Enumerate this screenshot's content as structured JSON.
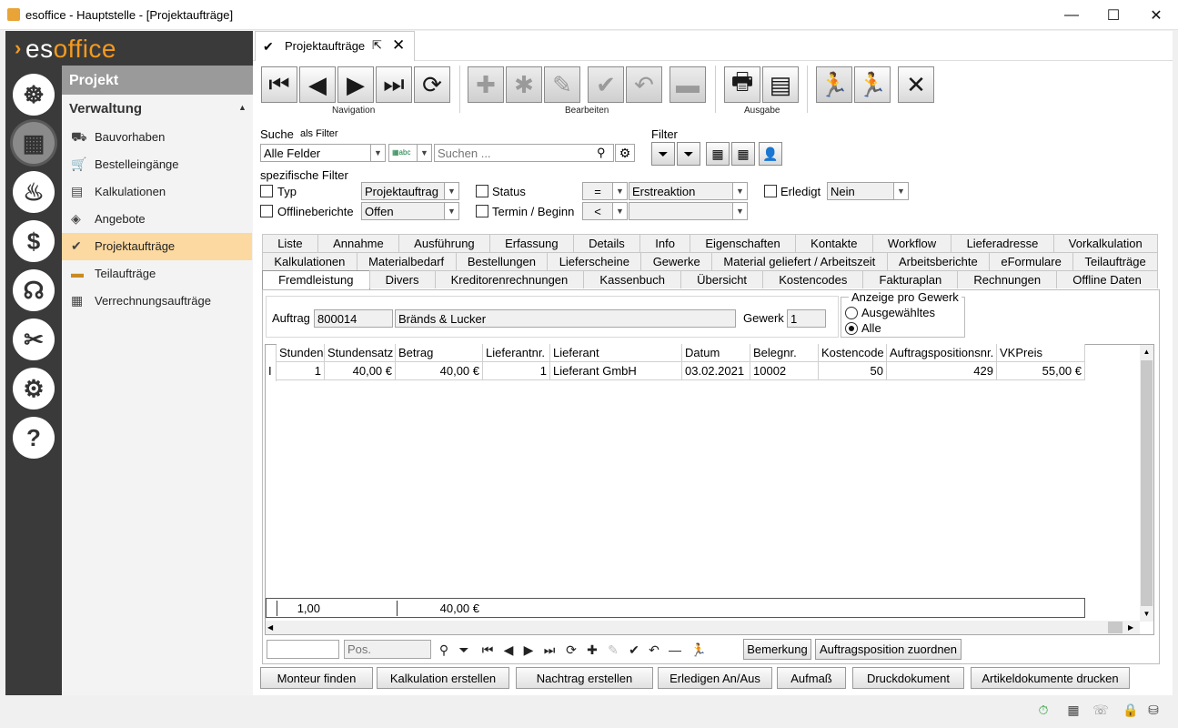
{
  "window": {
    "title": "esoffice - Hauptstelle - [Projektaufträge]",
    "minimize": "—",
    "maximize": "☐",
    "close": "✕"
  },
  "brand": {
    "logo_mark": "›",
    "logo_prefix": "es",
    "logo_suffix": "office",
    "accent": "#f39a1e"
  },
  "rail": [
    "steering-wheel-icon",
    "project-icon",
    "alarm-icon",
    "money-icon",
    "headset-icon",
    "tools-icon",
    "gears-icon",
    "help-icon"
  ],
  "nav": {
    "header": "Projekt",
    "section": "Verwaltung",
    "items": [
      {
        "label": "Bauvorhaben",
        "icon": "excavator-icon"
      },
      {
        "label": "Bestelleingänge",
        "icon": "cart-icon"
      },
      {
        "label": "Kalkulationen",
        "icon": "calculator-icon"
      },
      {
        "label": "Angebote",
        "icon": "offer-icon"
      },
      {
        "label": "Projektaufträge",
        "icon": "check-circle-icon",
        "selected": true
      },
      {
        "label": "Teilaufträge",
        "icon": "stack-icon"
      },
      {
        "label": "Verrechnungsaufträge",
        "icon": "billing-icon"
      }
    ]
  },
  "doctab": {
    "label": "Projektaufträge"
  },
  "toolbar": {
    "navigation_label": "Navigation",
    "edit_label": "Bearbeiten",
    "output_label": "Ausgabe"
  },
  "search": {
    "label": "Suche",
    "as_filter": "als Filter",
    "scope": "Alle Felder",
    "placeholder": "Suchen ..."
  },
  "filter": {
    "label": "Filter",
    "specific": "spezifische Filter"
  },
  "specific_filters": {
    "typ_label": "Typ",
    "typ_value": "Projektauftrag",
    "status_label": "Status",
    "status_op": "=",
    "status_value": "Erstreaktion",
    "erledigt_label": "Erledigt",
    "erledigt_value": "Nein",
    "offline_label": "Offlineberichte",
    "offline_value": "Offen",
    "termin_label": "Termin / Beginn",
    "termin_op": "<",
    "termin_value": ""
  },
  "tabs_row1": [
    "Liste",
    "Annahme",
    "Ausführung",
    "Erfassung",
    "Details",
    "Info",
    "Eigenschaften",
    "Kontakte",
    "Workflow",
    "Lieferadresse",
    "Vorkalkulation"
  ],
  "tabs_row2": [
    "Kalkulationen",
    "Materialbedarf",
    "Bestellungen",
    "Lieferscheine",
    "Gewerke",
    "Material geliefert / Arbeitszeit",
    "Arbeitsberichte",
    "eFormulare",
    "Teilaufträge"
  ],
  "tabs_row3": [
    "Fremdleistung",
    "Divers",
    "Kreditorenrechnungen",
    "Kassenbuch",
    "Übersicht",
    "Kostencodes",
    "Fakturaplan",
    "Rechnungen",
    "Offline Daten"
  ],
  "order": {
    "auftrag_label": "Auftrag",
    "auftrag_nr": "800014",
    "auftrag_name": "Bränds & Lucker",
    "gewerk_label": "Gewerk",
    "gewerk_value": "1"
  },
  "gewerk_group": {
    "title": "Anzeige pro Gewerk",
    "opt1": "Ausgewähltes",
    "opt2": "Alle",
    "selected": "Alle"
  },
  "grid": {
    "columns": [
      "Stunden",
      "Stundensatz",
      "Betrag",
      "Lieferantnr.",
      "Lieferant",
      "Datum",
      "Belegnr.",
      "Kostencode",
      "Auftragspositionsnr.",
      "VKPreis"
    ],
    "rows": [
      [
        "1",
        "40,00 €",
        "40,00 €",
        "1",
        "Lieferant GmbH",
        "03.02.2021",
        "10002",
        "50",
        "429",
        "55,00 €"
      ]
    ],
    "totals": {
      "stunden": "1,00",
      "betrag": "40,00 €"
    }
  },
  "gridnav": {
    "pos_placeholder": "Pos.",
    "bemerkung": "Bemerkung",
    "zuordnen": "Auftragsposition zuordnen"
  },
  "bottom_buttons": [
    "Monteur finden",
    "Kalkulation erstellen",
    "Nachtrag erstellen",
    "Erledigen An/Aus",
    "Aufmaß",
    "Druckdokument",
    "Artikeldokumente drucken"
  ]
}
